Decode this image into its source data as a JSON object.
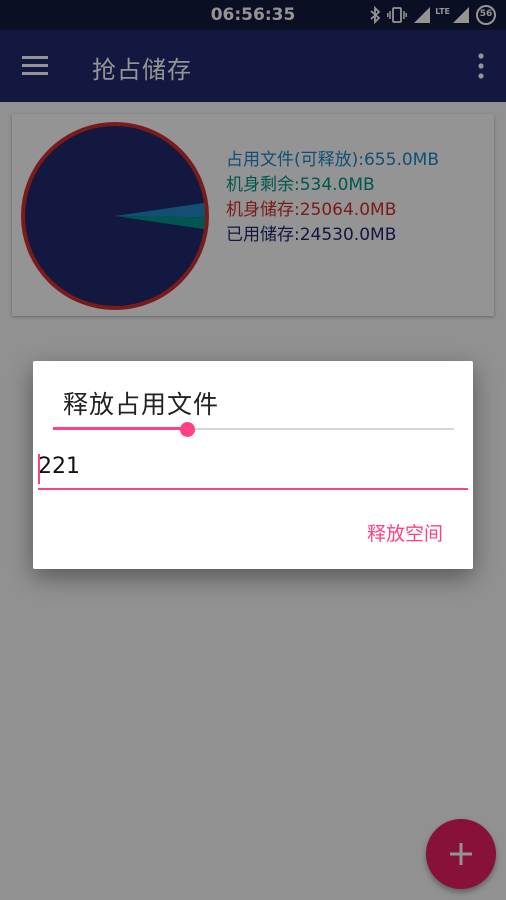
{
  "status_bar": {
    "time": "06:56:35",
    "battery_level": "56",
    "network": "LTE",
    "icons": [
      "bluetooth-icon",
      "vibrate-icon",
      "wifi-signal-icon",
      "cell-signal-icon",
      "battery-icon"
    ]
  },
  "app_bar": {
    "title": "抢占储存",
    "icons": [
      "menu-icon",
      "more-vert-icon"
    ]
  },
  "storage_card": {
    "legend": [
      {
        "label": "占用文件(可释放):655.0MB",
        "color": "#1e88c7"
      },
      {
        "label": "机身剩余:534.0MB",
        "color": "#009688"
      },
      {
        "label": "机身储存:25064.0MB",
        "color": "#d32f2f"
      },
      {
        "label": "已用储存:24530.0MB",
        "color": "#1f2a6f"
      }
    ]
  },
  "chart_data": {
    "type": "pie",
    "series": [
      {
        "name": "占用文件(可释放)",
        "value": 655.0,
        "color": "#1e88c7"
      },
      {
        "name": "机身剩余",
        "value": 534.0,
        "color": "#009688"
      },
      {
        "name": "已用储存",
        "value": 24530.0,
        "color": "#1f2a6f"
      }
    ],
    "total": 25064.0,
    "outline_color": "#d32f2f"
  },
  "dialog": {
    "title": "释放占用文件",
    "slider_fraction": 0.335,
    "input_value": "221",
    "action_button": "释放空间",
    "accent_color": "#ff4081"
  },
  "fab": {
    "icon": "add-icon",
    "color": "#e91e63"
  }
}
